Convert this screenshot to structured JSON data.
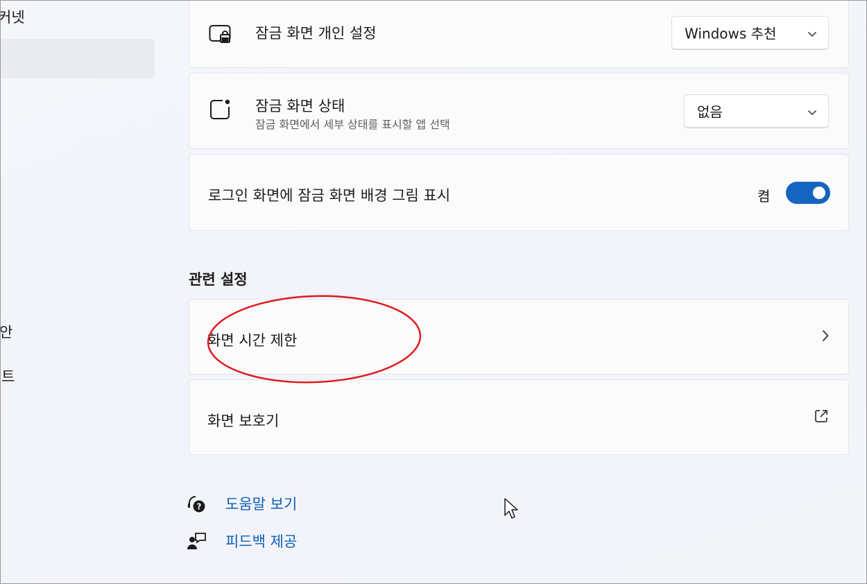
{
  "sidebar": {
    "partial_items": [
      {
        "label": "커넷"
      },
      {
        "label": "안"
      },
      {
        "label": "|트"
      }
    ]
  },
  "settings": {
    "lock_screen_personalize": {
      "title": "잠금 화면 개인 설정",
      "value": "Windows 추천",
      "icon": "lock-screen-icon"
    },
    "lock_screen_status": {
      "title": "잠금 화면 상태",
      "description": "잠금 화면에서 세부 상태를 표시할 앱 선택",
      "value": "없음",
      "icon": "status-icon"
    },
    "signin_background": {
      "title": "로그인 화면에 잠금 화면 배경 그림 표시",
      "toggle_state": "켬",
      "toggle_on": true
    }
  },
  "related": {
    "heading": "관련 설정",
    "items": [
      {
        "label": "화면 시간 제한",
        "icon": "chevron-right-icon"
      },
      {
        "label": "화면 보호기",
        "icon": "external-link-icon"
      }
    ]
  },
  "links": {
    "help": {
      "label": "도움말 보기",
      "icon": "help-icon"
    },
    "feedback": {
      "label": "피드백 제공",
      "icon": "feedback-icon"
    }
  },
  "colors": {
    "accent": "#1565c0",
    "link": "#0a5fb4",
    "annotation": "#e0191e"
  }
}
